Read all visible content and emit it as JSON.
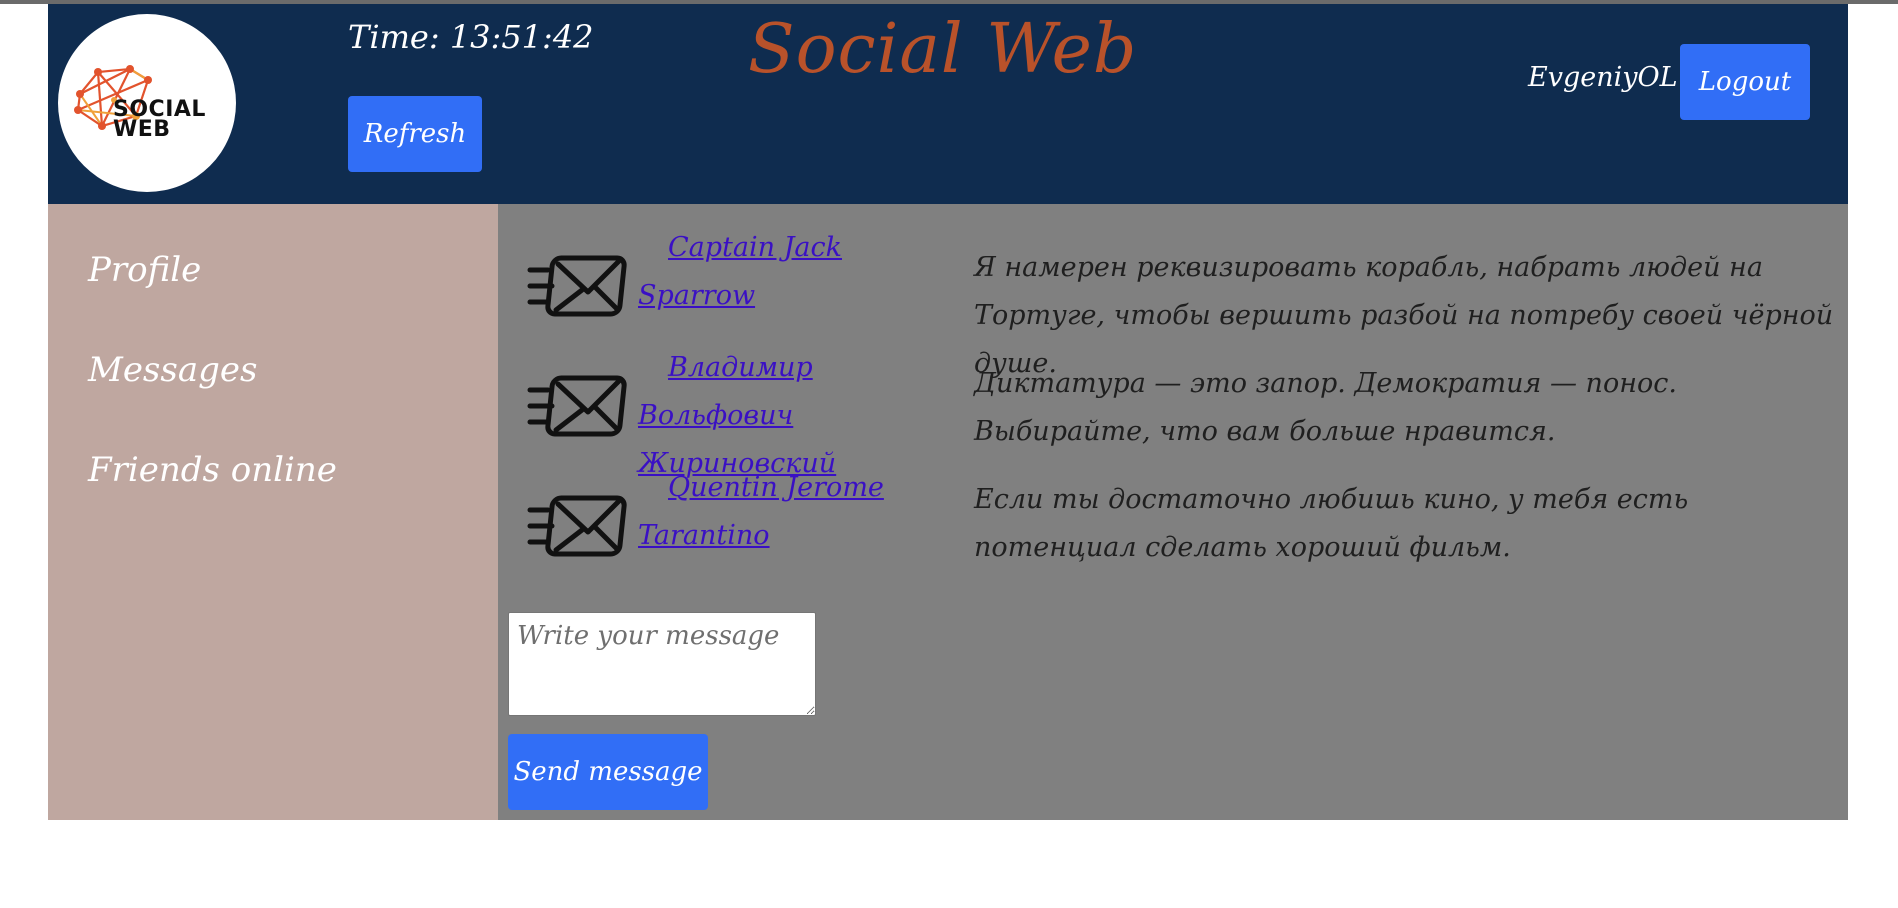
{
  "header": {
    "logo_text": "SOCIAL\nWEB",
    "time_text": "Time: 13:51:42",
    "refresh_label": "Refresh",
    "site_title": "Social Web",
    "username": "EvgeniyOL -",
    "logout_label": "Logout"
  },
  "sidebar": {
    "items": [
      {
        "label": "Profile"
      },
      {
        "label": "Messages"
      },
      {
        "label": "Friends online"
      }
    ]
  },
  "messages": [
    {
      "sender": "Captain Jack Sparrow",
      "text": "Я намерен реквизировать корабль, набрать людей на Тортуге, чтобы вершить разбой на потребу своей чёрной душе.",
      "icon": "envelope-icon"
    },
    {
      "sender": "Владимир Вольфович Жириновский",
      "text": "Диктатура — это запор. Демократия — понос. Выбирайте, что вам больше нравится.",
      "icon": "envelope-icon"
    },
    {
      "sender": "Quentin Jerome Tarantino",
      "text": "Если ты достаточно любишь кино, у тебя есть потенциал сделать хороший фильм.",
      "icon": "envelope-icon"
    }
  ],
  "composer": {
    "placeholder": "Write your message",
    "value": "",
    "send_label": "Send message"
  },
  "colors": {
    "header_bg": "#0f2c4f",
    "sidebar_bg": "#bfa7a0",
    "main_bg": "#808080",
    "button_bg": "#316ef6",
    "title": "#b9522a",
    "link": "#3a10c4"
  }
}
